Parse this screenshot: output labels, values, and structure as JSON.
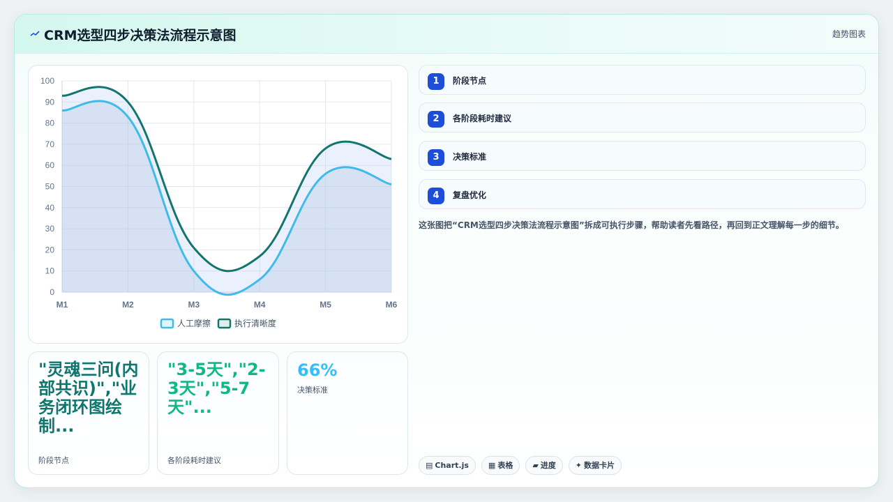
{
  "header": {
    "title": "CRM选型四步决策法流程示意图",
    "tag": "趋势图表"
  },
  "chart_data": {
    "type": "area",
    "categories": [
      "M1",
      "M2",
      "M3",
      "M4",
      "M5",
      "M6"
    ],
    "ylim": [
      0,
      100
    ],
    "yticks": [
      0,
      10,
      20,
      30,
      40,
      50,
      60,
      70,
      80,
      90,
      100
    ],
    "series": [
      {
        "name": "人工摩擦",
        "values": [
          86,
          83,
          10,
          6,
          56,
          51
        ],
        "color": "#3ebbe8"
      },
      {
        "name": "执行清晰度",
        "values": [
          93,
          90,
          21,
          17,
          68,
          63
        ],
        "color": "#14756e"
      }
    ],
    "legend": "bottom",
    "grid": true
  },
  "kpis": [
    {
      "value": "\"灵魂三问(内部共识)\",\"业务闭环图绘制...",
      "label": "阶段节点"
    },
    {
      "value": "\"3-5天\",\"2-3天\",\"5-7天\"...",
      "label": "各阶段耗时建议"
    },
    {
      "value": "66%",
      "label": "决策标准"
    }
  ],
  "steps": [
    {
      "num": "1",
      "label": "阶段节点"
    },
    {
      "num": "2",
      "label": "各阶段耗时建议"
    },
    {
      "num": "3",
      "label": "决策标准"
    },
    {
      "num": "4",
      "label": "复盘优化"
    }
  ],
  "description": "这张图把“CRM选型四步决策法流程示意图”拆成可执行步骤，帮助读者先看路径，再回到正文理解每一步的细节。",
  "chips": [
    {
      "icon": "▤",
      "label": "Chart.js"
    },
    {
      "icon": "▦",
      "label": "表格"
    },
    {
      "icon": "▰",
      "label": "进度"
    },
    {
      "icon": "✦",
      "label": "数据卡片"
    }
  ]
}
